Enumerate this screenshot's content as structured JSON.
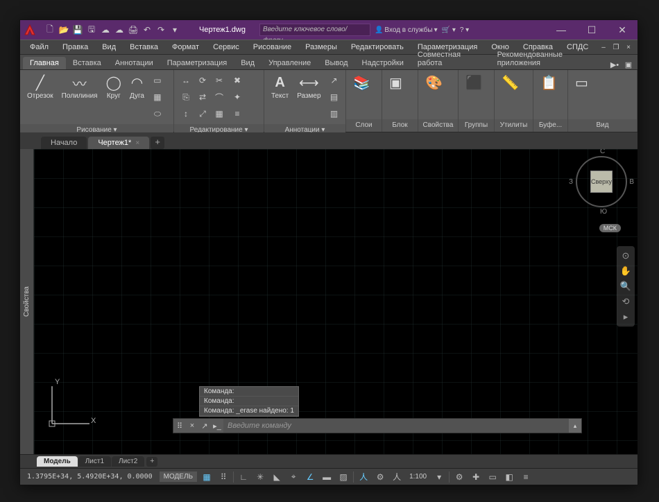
{
  "title": "Чертеж1.dwg",
  "search_placeholder": "Введите ключевое слово/фразу",
  "signin": "Вход в службы",
  "menu": [
    "Файл",
    "Правка",
    "Вид",
    "Вставка",
    "Формат",
    "Сервис",
    "Рисование",
    "Размеры",
    "Редактировать",
    "Параметризация",
    "Окно",
    "Справка",
    "СПДС"
  ],
  "ribbon_tabs": [
    "Главная",
    "Вставка",
    "Аннотации",
    "Параметризация",
    "Вид",
    "Управление",
    "Вывод",
    "Надстройки",
    "Совместная работа",
    "Рекомендованные приложения"
  ],
  "ribbon_active": 0,
  "panels": {
    "draw": {
      "title": "Рисование ▾",
      "items": [
        "Отрезок",
        "Полилиния",
        "Круг",
        "Дуга"
      ]
    },
    "modify": {
      "title": "Редактирование ▾"
    },
    "annot": {
      "title": "Аннотации ▾",
      "text": "Текст",
      "dim": "Размер"
    },
    "layers": {
      "title": "Слои"
    },
    "block": {
      "title": "Блок"
    },
    "props": {
      "title": "Свойства"
    },
    "groups": {
      "title": "Группы"
    },
    "utils": {
      "title": "Утилиты"
    },
    "clip": {
      "title": "Буфе..."
    },
    "view": {
      "title": "Вид"
    }
  },
  "doc_tabs": {
    "start": "Начало",
    "current": "Чертеж1*"
  },
  "side_panel": "Свойства",
  "viewcube": {
    "top": "Сверху",
    "n": "С",
    "s": "Ю",
    "e": "В",
    "w": "З"
  },
  "wcs_tag": "МСК",
  "ucs": {
    "x": "X",
    "y": "Y"
  },
  "cmd_history": [
    "Команда:",
    "Команда:",
    "Команда: _erase найдено: 1"
  ],
  "cmd_placeholder": "Введите команду",
  "layout_tabs": [
    "Модель",
    "Лист1",
    "Лист2"
  ],
  "status": {
    "coords": "1.3795E+34, 5.4920E+34, 0.0000",
    "model": "МОДЕЛЬ",
    "scale": "1:100"
  }
}
